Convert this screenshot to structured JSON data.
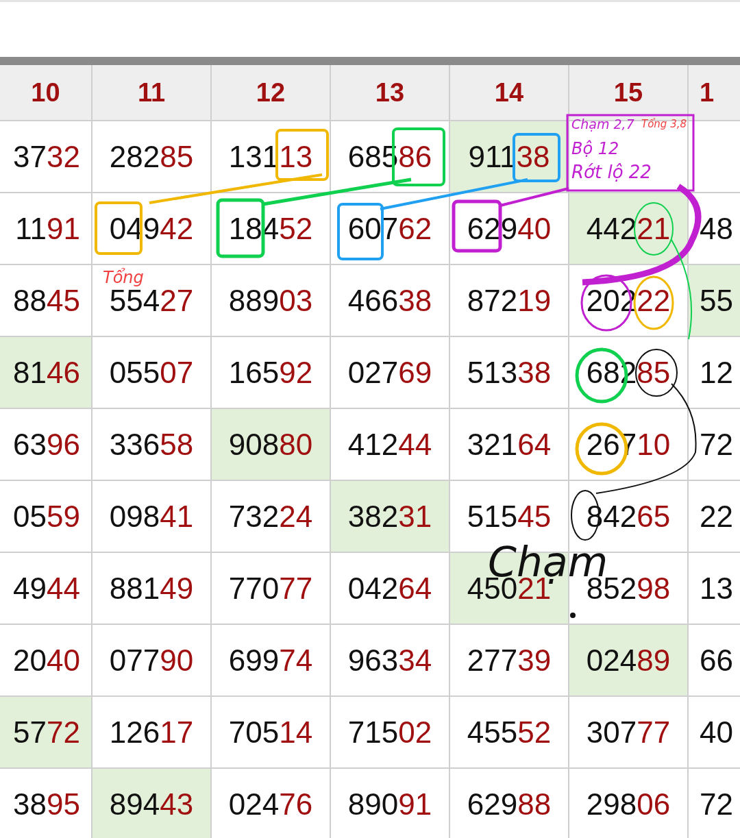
{
  "table": {
    "columns": [
      "10",
      "11",
      "12",
      "13",
      "14",
      "15",
      "1"
    ],
    "rows": [
      [
        {
          "head": "37",
          "tail": "32",
          "highlighted": false
        },
        {
          "head": "282",
          "tail": "85",
          "highlighted": false
        },
        {
          "head": "131",
          "tail": "13",
          "highlighted": false
        },
        {
          "head": "685",
          "tail": "86",
          "highlighted": false
        },
        {
          "head": "911",
          "tail": "38",
          "highlighted": true
        },
        null,
        null
      ],
      [
        {
          "head": "11",
          "tail": "91",
          "highlighted": false
        },
        {
          "head": "049",
          "tail": "42",
          "highlighted": false
        },
        {
          "head": "184",
          "tail": "52",
          "highlighted": false
        },
        {
          "head": "607",
          "tail": "62",
          "highlighted": false
        },
        {
          "head": "629",
          "tail": "40",
          "highlighted": false
        },
        {
          "head": "442",
          "tail": "21",
          "highlighted": true
        },
        {
          "head": "48",
          "highlighted": false
        }
      ],
      [
        {
          "head": "88",
          "tail": "45",
          "highlighted": false
        },
        {
          "head": "554",
          "tail": "27",
          "highlighted": false
        },
        {
          "head": "889",
          "tail": "03",
          "highlighted": false
        },
        {
          "head": "466",
          "tail": "38",
          "highlighted": false
        },
        {
          "head": "872",
          "tail": "19",
          "highlighted": false
        },
        {
          "head": "202",
          "tail": "22",
          "highlighted": false
        },
        {
          "head": "55",
          "highlighted": true
        }
      ],
      [
        {
          "head": "81",
          "tail": "46",
          "highlighted": true
        },
        {
          "head": "055",
          "tail": "07",
          "highlighted": false
        },
        {
          "head": "165",
          "tail": "92",
          "highlighted": false
        },
        {
          "head": "027",
          "tail": "69",
          "highlighted": false
        },
        {
          "head": "513",
          "tail": "38",
          "highlighted": false
        },
        {
          "head": "682",
          "tail": "85",
          "highlighted": false
        },
        {
          "head": "12",
          "highlighted": false
        }
      ],
      [
        {
          "head": "63",
          "tail": "96",
          "highlighted": false
        },
        {
          "head": "336",
          "tail": "58",
          "highlighted": false
        },
        {
          "head": "908",
          "tail": "80",
          "highlighted": true
        },
        {
          "head": "412",
          "tail": "44",
          "highlighted": false
        },
        {
          "head": "321",
          "tail": "64",
          "highlighted": false
        },
        {
          "head": "267",
          "tail": "10",
          "highlighted": false
        },
        {
          "head": "72",
          "highlighted": false
        }
      ],
      [
        {
          "head": "05",
          "tail": "59",
          "highlighted": false
        },
        {
          "head": "098",
          "tail": "41",
          "highlighted": false
        },
        {
          "head": "732",
          "tail": "24",
          "highlighted": false
        },
        {
          "head": "382",
          "tail": "31",
          "highlighted": true
        },
        {
          "head": "515",
          "tail": "45",
          "highlighted": false
        },
        {
          "head": "842",
          "tail": "65",
          "highlighted": false
        },
        {
          "head": "22",
          "highlighted": false
        }
      ],
      [
        {
          "head": "49",
          "tail": "44",
          "highlighted": false
        },
        {
          "head": "881",
          "tail": "49",
          "highlighted": false
        },
        {
          "head": "770",
          "tail": "77",
          "highlighted": false
        },
        {
          "head": "042",
          "tail": "64",
          "highlighted": false
        },
        {
          "head": "450",
          "tail": "21",
          "highlighted": true
        },
        {
          "head": "852",
          "tail": "98",
          "highlighted": false
        },
        {
          "head": "13",
          "highlighted": false
        }
      ],
      [
        {
          "head": "20",
          "tail": "40",
          "highlighted": false
        },
        {
          "head": "077",
          "tail": "90",
          "highlighted": false
        },
        {
          "head": "699",
          "tail": "74",
          "highlighted": false
        },
        {
          "head": "963",
          "tail": "34",
          "highlighted": false
        },
        {
          "head": "277",
          "tail": "39",
          "highlighted": false
        },
        {
          "head": "024",
          "tail": "89",
          "highlighted": true
        },
        {
          "head": "66",
          "highlighted": false
        }
      ],
      [
        {
          "head": "57",
          "tail": "72",
          "highlighted": true
        },
        {
          "head": "126",
          "tail": "17",
          "highlighted": false
        },
        {
          "head": "705",
          "tail": "14",
          "highlighted": false
        },
        {
          "head": "715",
          "tail": "02",
          "highlighted": false
        },
        {
          "head": "455",
          "tail": "52",
          "highlighted": false
        },
        {
          "head": "307",
          "tail": "77",
          "highlighted": false
        },
        {
          "head": "40",
          "highlighted": false
        }
      ],
      [
        {
          "head": "38",
          "tail": "95",
          "highlighted": false
        },
        {
          "head": "894",
          "tail": "43",
          "highlighted": true
        },
        {
          "head": "024",
          "tail": "76",
          "highlighted": false
        },
        {
          "head": "890",
          "tail": "91",
          "highlighted": false
        },
        {
          "head": "629",
          "tail": "88",
          "highlighted": false
        },
        {
          "head": "298",
          "tail": "06",
          "highlighted": false
        },
        {
          "head": "72",
          "highlighted": false
        }
      ]
    ]
  },
  "annotations": [
    {
      "text": "Chạm 2,7",
      "color": "#c020d0"
    },
    {
      "text": "Tổng 3,8",
      "color": "#f04040"
    },
    {
      "text": "Bộ 12",
      "color": "#c020d0"
    },
    {
      "text": "Rớt lộ 22",
      "color": "#c020d0"
    },
    {
      "text": "Tổng",
      "color": "#f04040"
    },
    {
      "text": "Chạm",
      "color": "#111111"
    }
  ]
}
